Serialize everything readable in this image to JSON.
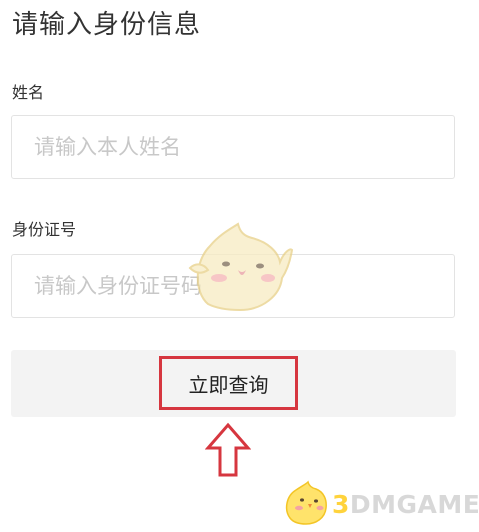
{
  "page": {
    "title": "请输入身份信息"
  },
  "form": {
    "name_label": "姓名",
    "name_placeholder": "请输入本人姓名",
    "id_label": "身份证号",
    "id_placeholder": "请输入身份证号码",
    "submit_label": "立即查询"
  },
  "annotation": {
    "highlight_color": "#d6363f",
    "arrow_icon": "up-arrow-icon"
  },
  "watermark": {
    "brand_digit": "3",
    "brand_text": "DMGAME",
    "mascot_icon": "chick-mascot-icon"
  }
}
